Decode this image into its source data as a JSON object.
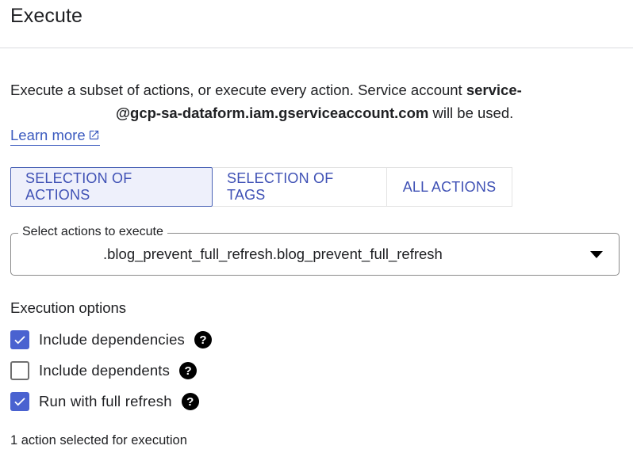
{
  "header": {
    "title": "Execute"
  },
  "description": {
    "text_before": "Execute a subset of actions, or execute every action. Service account ",
    "account_bold_1": "service-",
    "account_bold_2": "@gcp-sa-dataform.iam.gserviceaccount.com",
    "text_after": " will be used."
  },
  "learn_more": {
    "label": "Learn more",
    "icon": "open-in-new-icon"
  },
  "tabs": [
    {
      "label": "SELECTION OF ACTIONS",
      "active": true
    },
    {
      "label": "SELECTION OF TAGS",
      "active": false
    },
    {
      "label": "ALL ACTIONS",
      "active": false
    }
  ],
  "select": {
    "label": "Select actions to execute",
    "value": ".blog_prevent_full_refresh.blog_prevent_full_refresh",
    "icon": "dropdown-arrow-icon"
  },
  "execution_options": {
    "title": "Execution options",
    "options": [
      {
        "label": "Include dependencies",
        "checked": true,
        "help_icon": "help-icon"
      },
      {
        "label": "Include dependents",
        "checked": false,
        "help_icon": "help-icon"
      },
      {
        "label": "Run with full refresh",
        "checked": true,
        "help_icon": "help-icon"
      }
    ]
  },
  "status": {
    "text": "1 action selected for execution"
  },
  "colors": {
    "accent": "#3f51b5",
    "checkbox": "#4a62d0",
    "active_tab_bg": "#eef0fb",
    "link": "#3c5bbf"
  }
}
